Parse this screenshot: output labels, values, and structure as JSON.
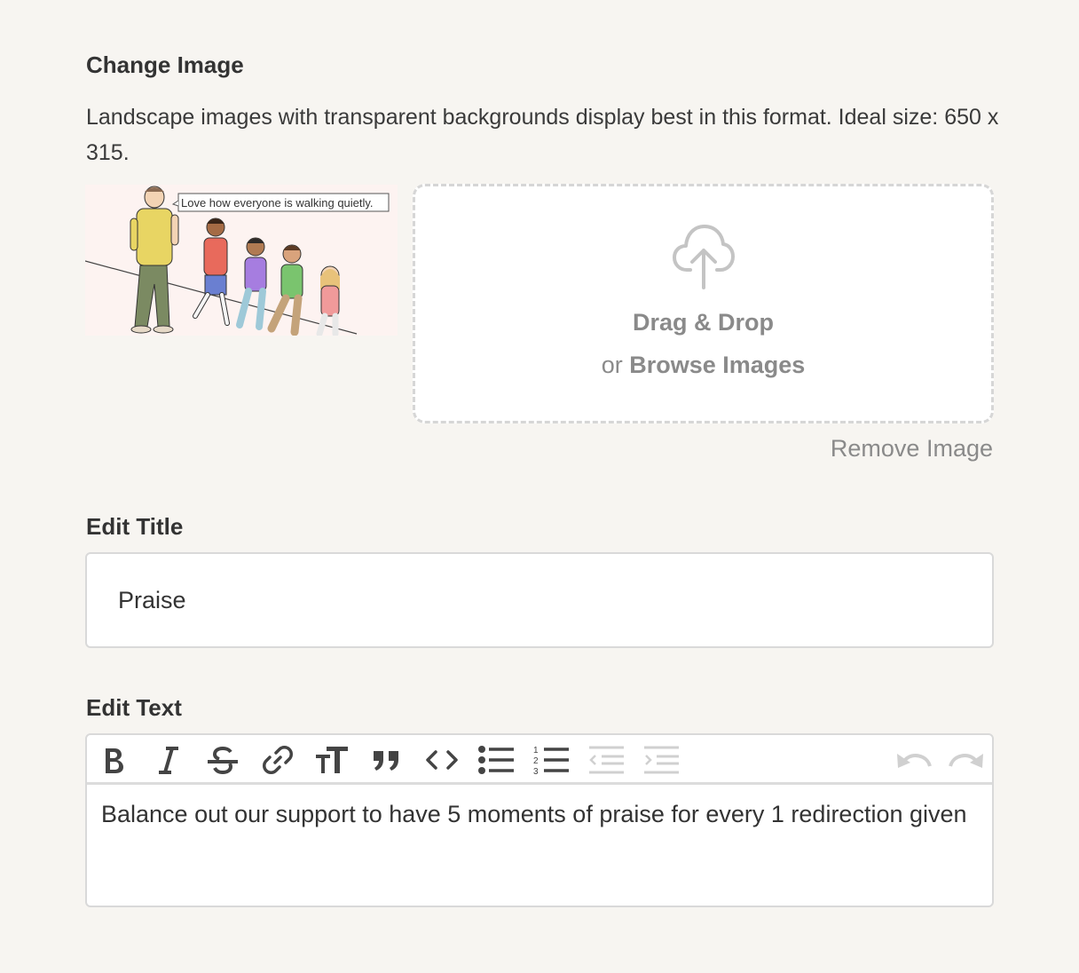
{
  "change_image": {
    "label": "Change Image",
    "help_text": "Landscape images with transparent backgrounds display best in this format. Ideal size: 650 x 315.",
    "thumbnail_caption": "Love how everyone is walking quietly.",
    "dropzone": {
      "icon": "cloud-upload-icon",
      "title": "Drag & Drop",
      "or_text": "or",
      "browse_label": "Browse Images"
    },
    "remove_label": "Remove Image"
  },
  "edit_title": {
    "label": "Edit Title",
    "value": "Praise"
  },
  "edit_text": {
    "label": "Edit Text",
    "toolbar": [
      {
        "name": "bold-icon",
        "enabled": true
      },
      {
        "name": "italic-icon",
        "enabled": true
      },
      {
        "name": "strikethrough-icon",
        "enabled": true
      },
      {
        "name": "link-icon",
        "enabled": true
      },
      {
        "name": "heading-icon",
        "enabled": true
      },
      {
        "name": "quote-icon",
        "enabled": true
      },
      {
        "name": "code-icon",
        "enabled": true
      },
      {
        "name": "bullet-list-icon",
        "enabled": true
      },
      {
        "name": "numbered-list-icon",
        "enabled": true
      },
      {
        "name": "decrease-indent-icon",
        "enabled": false
      },
      {
        "name": "increase-indent-icon",
        "enabled": false
      },
      {
        "name": "undo-icon",
        "enabled": false
      },
      {
        "name": "redo-icon",
        "enabled": false
      }
    ],
    "body": "Balance out our support to have 5 moments of praise for every 1 redirection given"
  },
  "colors": {
    "background": "#f7f5f1",
    "text": "#333333",
    "muted": "#8a8a8a",
    "border": "#d9d9d9",
    "disabled_icon": "#d0d0d0"
  }
}
